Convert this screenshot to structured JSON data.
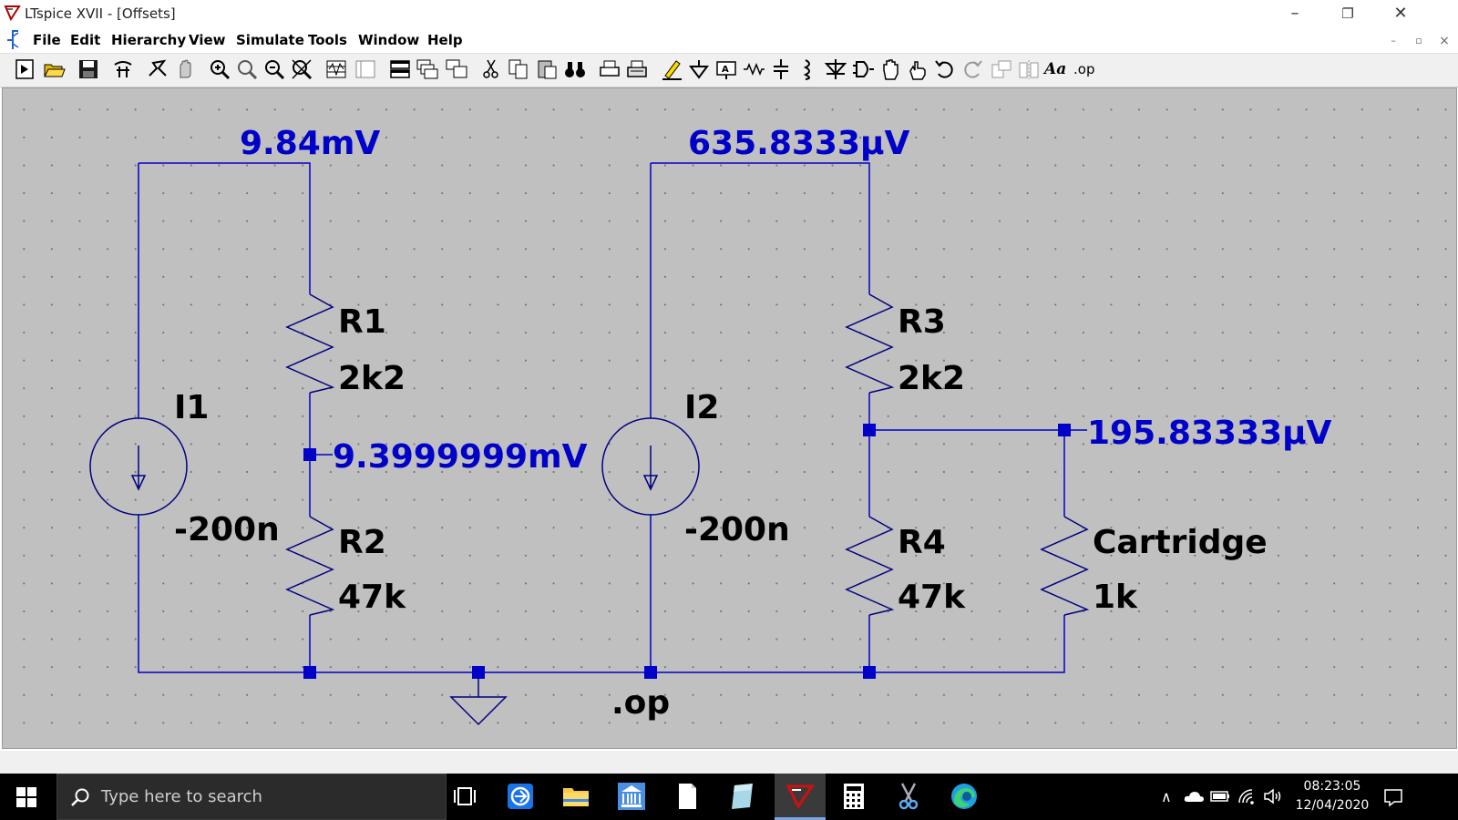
{
  "window": {
    "title": "LTspice XVII - [Offsets]",
    "controls": {
      "minimize": "–",
      "restore": "❐",
      "close": "✕"
    }
  },
  "menu": {
    "items": [
      "File",
      "Edit",
      "Hierarchy",
      "View",
      "Simulate",
      "Tools",
      "Window",
      "Help"
    ]
  },
  "mdi_controls": {
    "minimize": "–",
    "restore": "▫",
    "close": "×"
  },
  "toolbar": {
    "icons": [
      "new-schematic-icon",
      "open-icon",
      "save-icon",
      "control-panel-icon",
      "run-icon",
      "halt-icon",
      "zoom-in-icon",
      "zoom-full-icon",
      "zoom-out-icon",
      "zoom-cancel-icon",
      "waveform-icon",
      "autorange-icon",
      "tile-horizontal-icon",
      "cascade-icon",
      "tile-vertical-icon",
      "cut-icon",
      "copy-icon",
      "paste-icon",
      "find-icon",
      "print-setup-icon",
      "print-icon",
      "wire-icon",
      "ground-icon",
      "label-net-icon",
      "resistor-icon",
      "capacitor-icon",
      "inductor-icon",
      "diode-icon",
      "component-icon",
      "move-icon",
      "drag-icon",
      "undo-icon",
      "redo-icon",
      "rotate-icon",
      "mirror-icon",
      "text-icon",
      "spice-directive-icon"
    ],
    "text_tool": "Aa",
    "op_tool": ".op"
  },
  "schematic": {
    "wire_color": "#0000c8",
    "label_color": "#0000c8",
    "node_voltages": {
      "left_top": "9.84mV",
      "left_mid": "9.3999999mV",
      "right_top": "635.8333μV",
      "right_mid": "195.83333μV"
    },
    "components": {
      "I1": {
        "name": "I1",
        "value": "-200n"
      },
      "I2": {
        "name": "I2",
        "value": "-200n"
      },
      "R1": {
        "name": "R1",
        "value": "2k2"
      },
      "R2": {
        "name": "R2",
        "value": "47k"
      },
      "R3": {
        "name": "R3",
        "value": "2k2"
      },
      "R4": {
        "name": "R4",
        "value": "47k"
      },
      "Cartridge": {
        "name": "Cartridge",
        "value": "1k"
      }
    },
    "directive": ".op"
  },
  "taskbar": {
    "search_placeholder": "Type here to search",
    "time": "08:23:05",
    "date": "12/04/2020"
  }
}
